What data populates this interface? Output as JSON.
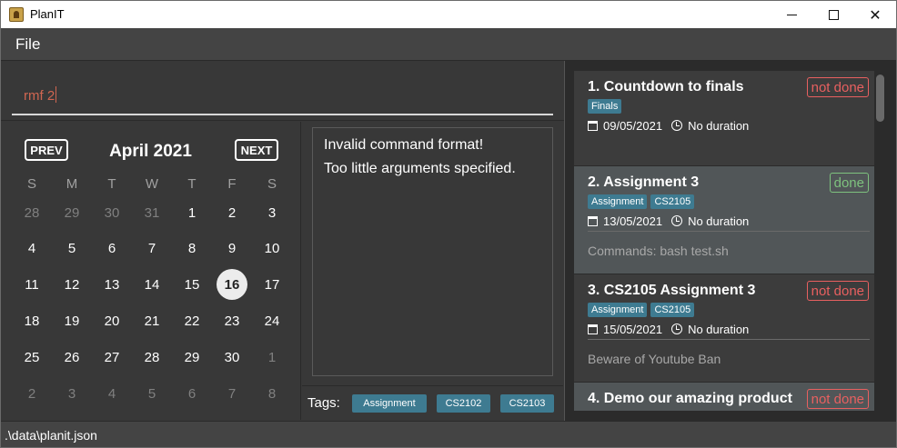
{
  "window": {
    "title": "PlanIT"
  },
  "menu": {
    "file_label": "File"
  },
  "command": {
    "value": "rmf 2"
  },
  "calendar": {
    "prev_label": "PREV",
    "next_label": "NEXT",
    "month_title": "April 2021",
    "weekdays": [
      "S",
      "M",
      "T",
      "W",
      "T",
      "F",
      "S"
    ],
    "today": "16",
    "weeks": [
      [
        "28",
        "29",
        "30",
        "31",
        "1",
        "2",
        "3"
      ],
      [
        "4",
        "5",
        "6",
        "7",
        "8",
        "9",
        "10"
      ],
      [
        "11",
        "12",
        "13",
        "14",
        "15",
        "16",
        "17"
      ],
      [
        "18",
        "19",
        "20",
        "21",
        "22",
        "23",
        "24"
      ],
      [
        "25",
        "26",
        "27",
        "28",
        "29",
        "30",
        "1"
      ],
      [
        "2",
        "3",
        "4",
        "5",
        "6",
        "7",
        "8"
      ]
    ]
  },
  "result": {
    "lines": [
      "Invalid command format!",
      "Too little arguments specified."
    ]
  },
  "tags_bar": {
    "label": "Tags:",
    "tags": [
      "Assignment",
      "CS2102",
      "CS2103"
    ]
  },
  "tasks": [
    {
      "title": "1.  Countdown to finals",
      "status": "not done",
      "status_kind": "notdone",
      "tags": [
        "Finals"
      ],
      "date": "09/05/2021",
      "duration": "No duration",
      "description": ""
    },
    {
      "title": "2.  Assignment 3",
      "status": "done",
      "status_kind": "done",
      "tags": [
        "Assignment",
        "CS2105"
      ],
      "date": "13/05/2021",
      "duration": "No duration",
      "description": "Commands: bash test.sh"
    },
    {
      "title": "3.  CS2105 Assignment 3",
      "status": "not done",
      "status_kind": "notdone",
      "tags": [
        "Assignment",
        "CS2105"
      ],
      "date": "15/05/2021",
      "duration": "No duration",
      "description": "Beware of Youtube Ban"
    },
    {
      "title": "4.  Demo our amazing product",
      "status": "not done",
      "status_kind": "notdone",
      "tags": [],
      "date": "",
      "duration": "",
      "description": ""
    }
  ],
  "statusbar": {
    "path": ".\\data\\planit.json"
  }
}
